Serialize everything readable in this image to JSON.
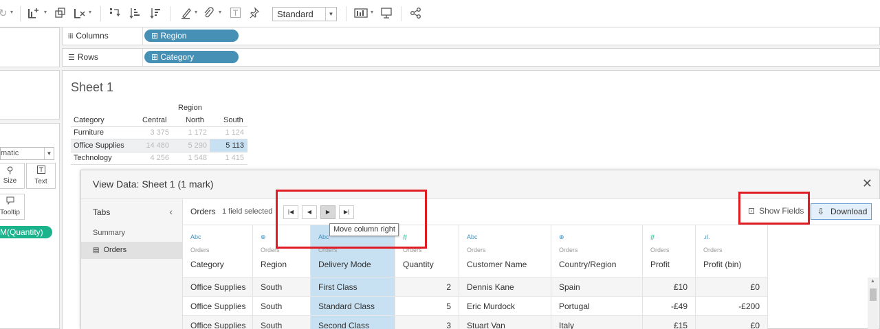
{
  "toolbar": {
    "mark_type_select": "Standard"
  },
  "left_panel": {
    "marks_type": "matic",
    "size_label": "Size",
    "text_label": "Text",
    "tooltip_label": "Tooltip",
    "quantity_pill": "M(Quantity)"
  },
  "shelves": {
    "columns_label": "Columns",
    "columns_pill": "Region",
    "rows_label": "Rows",
    "rows_pill": "Category"
  },
  "sheet": {
    "title": "Sheet 1",
    "col_header_title": "Region",
    "row_header_title": "Category",
    "columns": [
      "Central",
      "North",
      "South"
    ],
    "rows": [
      {
        "name": "Furniture",
        "values": [
          "3 375",
          "1 172",
          "1 124"
        ]
      },
      {
        "name": "Office Supplies",
        "values": [
          "14 480",
          "5 290",
          "5 113"
        ]
      },
      {
        "name": "Technology",
        "values": [
          "4 256",
          "1 548",
          "1 415"
        ]
      }
    ]
  },
  "dialog": {
    "title": "View Data: Sheet 1 (1 mark)",
    "tabs_label": "Tabs",
    "tabs": [
      {
        "label": "Summary"
      },
      {
        "label": "Orders"
      }
    ],
    "table_name": "Orders",
    "selection_info": "1 field selected",
    "tooltip": "Move column right",
    "show_fields": "Show Fields",
    "download": "Download",
    "columns": [
      {
        "type": "Abc",
        "source": "Orders",
        "name": "Category"
      },
      {
        "type": "globe",
        "source": "Orders",
        "name": "Region"
      },
      {
        "type": "Abc",
        "source": "Orders",
        "name": "Delivery Mode"
      },
      {
        "type": "#",
        "source": "Orders",
        "name": "Quantity"
      },
      {
        "type": "Abc",
        "source": "Orders",
        "name": "Customer Name"
      },
      {
        "type": "globe",
        "source": "Orders",
        "name": "Country/Region"
      },
      {
        "type": "#",
        "source": "Orders",
        "name": "Profit"
      },
      {
        "type": "bin",
        "source": "Orders",
        "name": "Profit (bin)"
      }
    ],
    "rows": [
      [
        "Office Supplies",
        "South",
        "First Class",
        "2",
        "Dennis Kane",
        "Spain",
        "£10",
        "£0"
      ],
      [
        "Office Supplies",
        "South",
        "Standard Class",
        "5",
        "Eric Murdock",
        "Portugal",
        "-£49",
        "-£200"
      ],
      [
        "Office Supplies",
        "South",
        "Second Class",
        "3",
        "Stuart Van",
        "Italy",
        "£15",
        "£0"
      ]
    ]
  },
  "colors": {
    "pill_blue": "#4690b5",
    "measure_green": "#1bb38c",
    "selection_blue": "#c8e1f2",
    "highlight_red": "#e01b24"
  }
}
